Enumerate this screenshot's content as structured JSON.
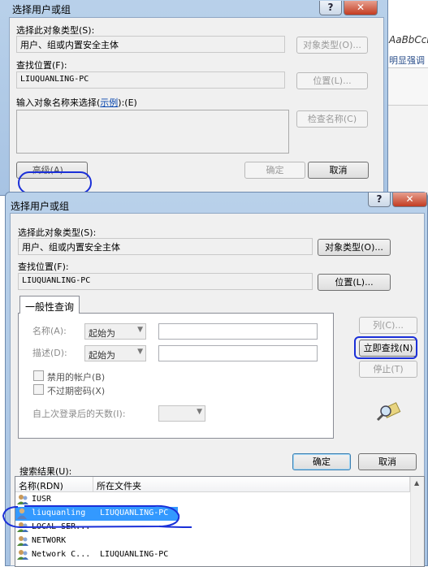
{
  "background_window": {
    "style_sample": "AaBbCcDd",
    "ribbon_text": "明显强调"
  },
  "dialog_back": {
    "title": "选择用户或组",
    "help_glyph": "?",
    "close_glyph": "✕",
    "object_type_label": "选择此对象类型(S):",
    "object_type_value": "用户、组或内置安全主体",
    "object_type_button": "对象类型(O)...",
    "location_label": "查找位置(F):",
    "location_value": "LIUQUANLING-PC",
    "location_button": "位置(L)...",
    "enter_names_label": "输入对象名称来选择(",
    "enter_names_link": "示例",
    "enter_names_label_end": "):(E)",
    "check_names_button": "检查名称(C)",
    "advanced_button": "高级(A)...",
    "ok_button": "确定",
    "cancel_button": "取消"
  },
  "dialog_front": {
    "title": "选择用户或组",
    "help_glyph": "?",
    "close_glyph": "✕",
    "object_type_label": "选择此对象类型(S):",
    "object_type_value": "用户、组或内置安全主体",
    "object_type_button": "对象类型(O)...",
    "location_label": "查找位置(F):",
    "location_value": "LIUQUANLING-PC",
    "location_button": "位置(L)...",
    "tab_general": "一般性查询",
    "name_label": "名称(A):",
    "name_select": "起始为",
    "desc_label": "描述(D):",
    "desc_select": "起始为",
    "disabled_accounts": "禁用的帐户(B)",
    "non_expiring_pw": "不过期密码(X)",
    "days_since_logon": "自上次登录后的天数(I):",
    "columns_button": "列(C)...",
    "find_now_button": "立即查找(N)",
    "stop_button": "停止(T)",
    "ok_button": "确定",
    "cancel_button": "取消",
    "results_label": "搜索结果(U):",
    "columns": [
      "名称(RDN)",
      "所在文件夹"
    ],
    "rows": [
      {
        "name": "IUSR",
        "folder": ""
      },
      {
        "name": "liuquanling",
        "folder": "LIUQUANLING-PC"
      },
      {
        "name": "LOCAL SER...",
        "folder": ""
      },
      {
        "name": "NETWORK",
        "folder": ""
      },
      {
        "name": "Network C...",
        "folder": "LIUQUANLING-PC"
      }
    ]
  }
}
